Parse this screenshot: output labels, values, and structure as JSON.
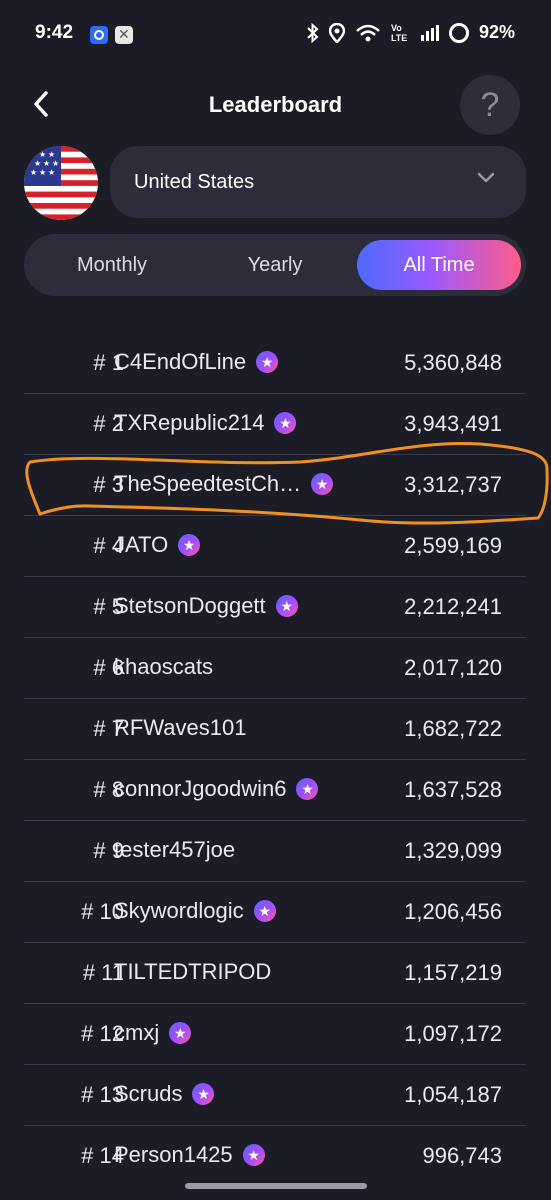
{
  "status_bar": {
    "time": "9:42",
    "signal_label": "Vo LTE",
    "battery": "92%",
    "icons": [
      "messenger-icon",
      "app-icon",
      "bluetooth-icon",
      "location-icon",
      "wifi-icon",
      "signal-icon",
      "battery-icon"
    ]
  },
  "header": {
    "title": "Leaderboard",
    "help_label": "?"
  },
  "country": {
    "selected": "United States",
    "flag": "us-flag-icon"
  },
  "tabs": [
    {
      "label": "Monthly",
      "active": false
    },
    {
      "label": "Yearly",
      "active": false
    },
    {
      "label": "All Time",
      "active": true
    }
  ],
  "colors": {
    "background": "#1c1c26",
    "card": "#2c2c3a",
    "accent_start": "#4c6bff",
    "accent_end": "#ff5c8a",
    "annotation": "#f0901f"
  },
  "leaderboard": [
    {
      "rank": "# 1",
      "name": "C4EndOfLine",
      "badge": true,
      "score": "5,360,848"
    },
    {
      "rank": "# 2",
      "name": "TXRepublic214",
      "badge": true,
      "score": "3,943,491"
    },
    {
      "rank": "# 3",
      "name": "TheSpeedtestCh…",
      "badge": true,
      "score": "3,312,737"
    },
    {
      "rank": "# 4",
      "name": "JATO",
      "badge": true,
      "score": "2,599,169"
    },
    {
      "rank": "# 5",
      "name": "StetsonDoggett",
      "badge": true,
      "score": "2,212,241"
    },
    {
      "rank": "# 6",
      "name": "khaoscats",
      "badge": false,
      "score": "2,017,120"
    },
    {
      "rank": "# 7",
      "name": "RFWaves101",
      "badge": false,
      "score": "1,682,722"
    },
    {
      "rank": "# 8",
      "name": "connorJgoodwin6",
      "badge": true,
      "score": "1,637,528"
    },
    {
      "rank": "# 9",
      "name": "tester457joe",
      "badge": false,
      "score": "1,329,099"
    },
    {
      "rank": "# 10",
      "name": "Skywordlogic",
      "badge": true,
      "score": "1,206,456"
    },
    {
      "rank": "# 11",
      "name": "TILTEDTRIPOD",
      "badge": false,
      "score": "1,157,219"
    },
    {
      "rank": "# 12",
      "name": "cmxj",
      "badge": true,
      "score": "1,097,172"
    },
    {
      "rank": "# 13",
      "name": "Scruds",
      "badge": true,
      "score": "1,054,187"
    },
    {
      "rank": "# 14",
      "name": "Person1425",
      "badge": true,
      "score": "996,743"
    }
  ]
}
